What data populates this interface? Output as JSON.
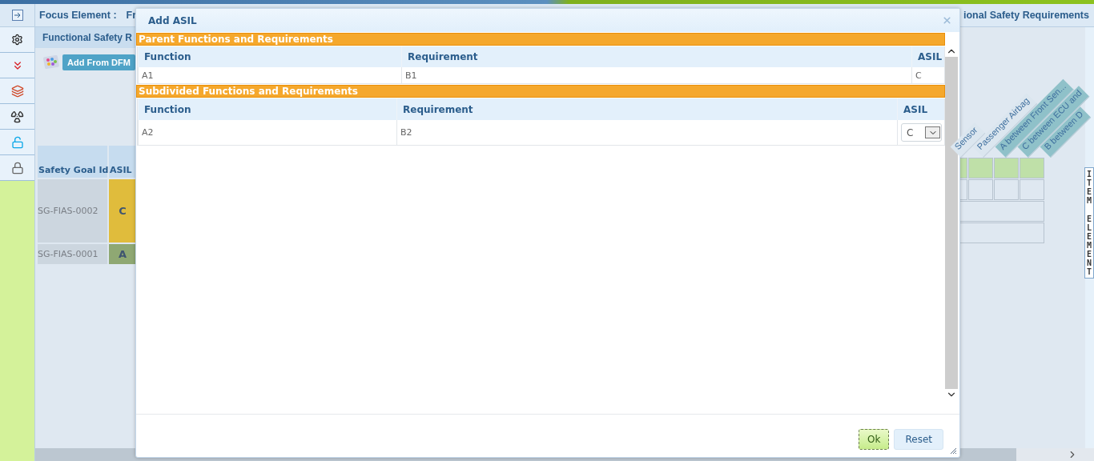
{
  "header": {
    "focus_label": "Focus Element :",
    "focus_value": "Fr",
    "page_title": "ional Safety Requirements"
  },
  "panel": {
    "title": "Functional Safety R",
    "add_button": "Add From DFM"
  },
  "goal_table": {
    "columns": [
      "Safety Goal Id",
      "ASIL"
    ],
    "rows": [
      {
        "id": "SG-FIAS-0002",
        "asil": "C",
        "color": "#e0bc3c"
      },
      {
        "id": "SG-FIAS-0001",
        "asil": "A",
        "color": "#8fa873"
      }
    ]
  },
  "matrix": {
    "headers": [
      {
        "label": "Sensor",
        "highlighted": false
      },
      {
        "label": "Passenger Airbag",
        "highlighted": false
      },
      {
        "label": "A between Front Sen...",
        "highlighted": true
      },
      {
        "label": "C between ECU and",
        "highlighted": true
      },
      {
        "label": "B between D",
        "highlighted": true
      }
    ]
  },
  "side_label": [
    "ITEM",
    "ELEMENT"
  ],
  "dialog": {
    "title": "Add ASIL",
    "sections": [
      {
        "title": "Parent Functions and Requirements",
        "kind": "parent",
        "columns": [
          "Function",
          "Requirement",
          "ASIL"
        ],
        "rows": [
          {
            "function": "A1",
            "requirement": "B1",
            "asil": "C",
            "kind": "text"
          }
        ]
      },
      {
        "title": "Subdivided Functions and Requirements",
        "kind": "subdivided",
        "columns": [
          "Function",
          "Requirement",
          "ASIL"
        ],
        "rows": [
          {
            "function": "A2",
            "requirement": "B2",
            "asil": "C",
            "kind": "select"
          }
        ]
      }
    ],
    "buttons": [
      {
        "label": "Ok",
        "kind": "primary"
      },
      {
        "label": "Reset",
        "kind": "secondary"
      }
    ]
  }
}
